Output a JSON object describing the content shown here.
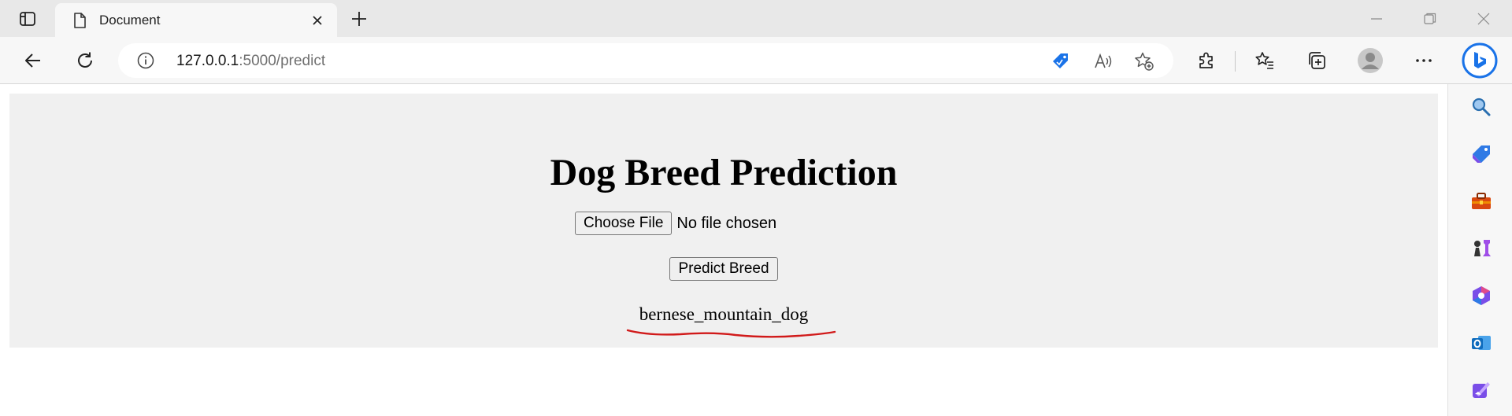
{
  "tab": {
    "title": "Document"
  },
  "address": {
    "host": "127.0.0.1",
    "path": ":5000/predict"
  },
  "page": {
    "heading": "Dog Breed Prediction",
    "choose_file_label": "Choose File",
    "file_status": "No file chosen",
    "predict_label": "Predict Breed",
    "result": "bernese_mountain_dog"
  },
  "colors": {
    "accent_blue": "#1a73e8",
    "underline_red": "#d11a1a"
  },
  "icons": {
    "tab_actions": "tab-actions-icon",
    "page": "page-icon",
    "close": "close-icon",
    "new_tab": "plus-icon",
    "back": "back-arrow-icon",
    "refresh": "refresh-icon",
    "info": "info-icon",
    "shopping": "shopping-tag-icon",
    "read_aloud": "read-aloud-icon",
    "favorite_add": "add-favorite-icon",
    "extensions": "puzzle-icon",
    "favorites": "favorites-icon",
    "collections": "collections-icon",
    "profile": "profile-icon",
    "more": "more-icon",
    "bing": "bing-chat-icon"
  }
}
